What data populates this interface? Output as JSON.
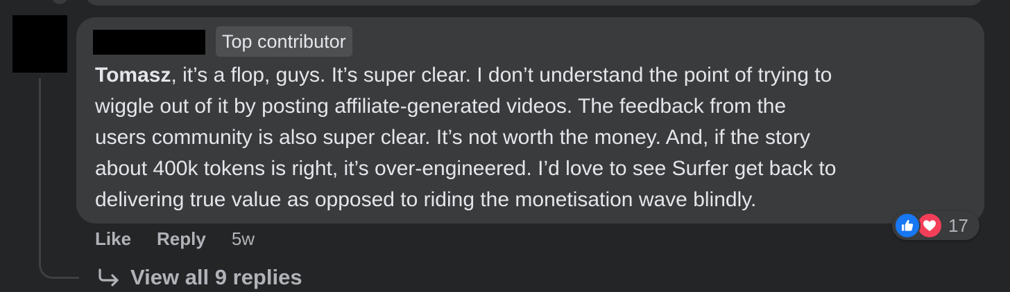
{
  "comment": {
    "author_name": "",
    "badge": "Top contributor",
    "mention": "Tomasz",
    "text_lines": [
      ", it’s a flop, guys. It’s super clear. I don’t understand the point of trying to",
      "wiggle out of it by posting affiliate-generated videos. The feedback from the",
      "users community is also super clear. It’s not worth the money. And, if the story",
      "about 400k tokens is right, it’s over-engineered. I’d love to see Surfer get back to",
      "delivering true value as opposed to riding the monetisation wave blindly."
    ],
    "actions": {
      "like_label": "Like",
      "reply_label": "Reply",
      "timestamp": "5w"
    },
    "reactions": {
      "icons": [
        "like-icon",
        "love-icon"
      ],
      "count": "17"
    }
  },
  "replies": {
    "view_all_label": "View all 9 replies"
  },
  "colors": {
    "background": "#242526",
    "bubble": "#3a3b3c",
    "text": "#e4e6eb",
    "secondary_text": "#b0b3b8",
    "like_blue": "#1877f2",
    "love_red": "#f33e58"
  }
}
